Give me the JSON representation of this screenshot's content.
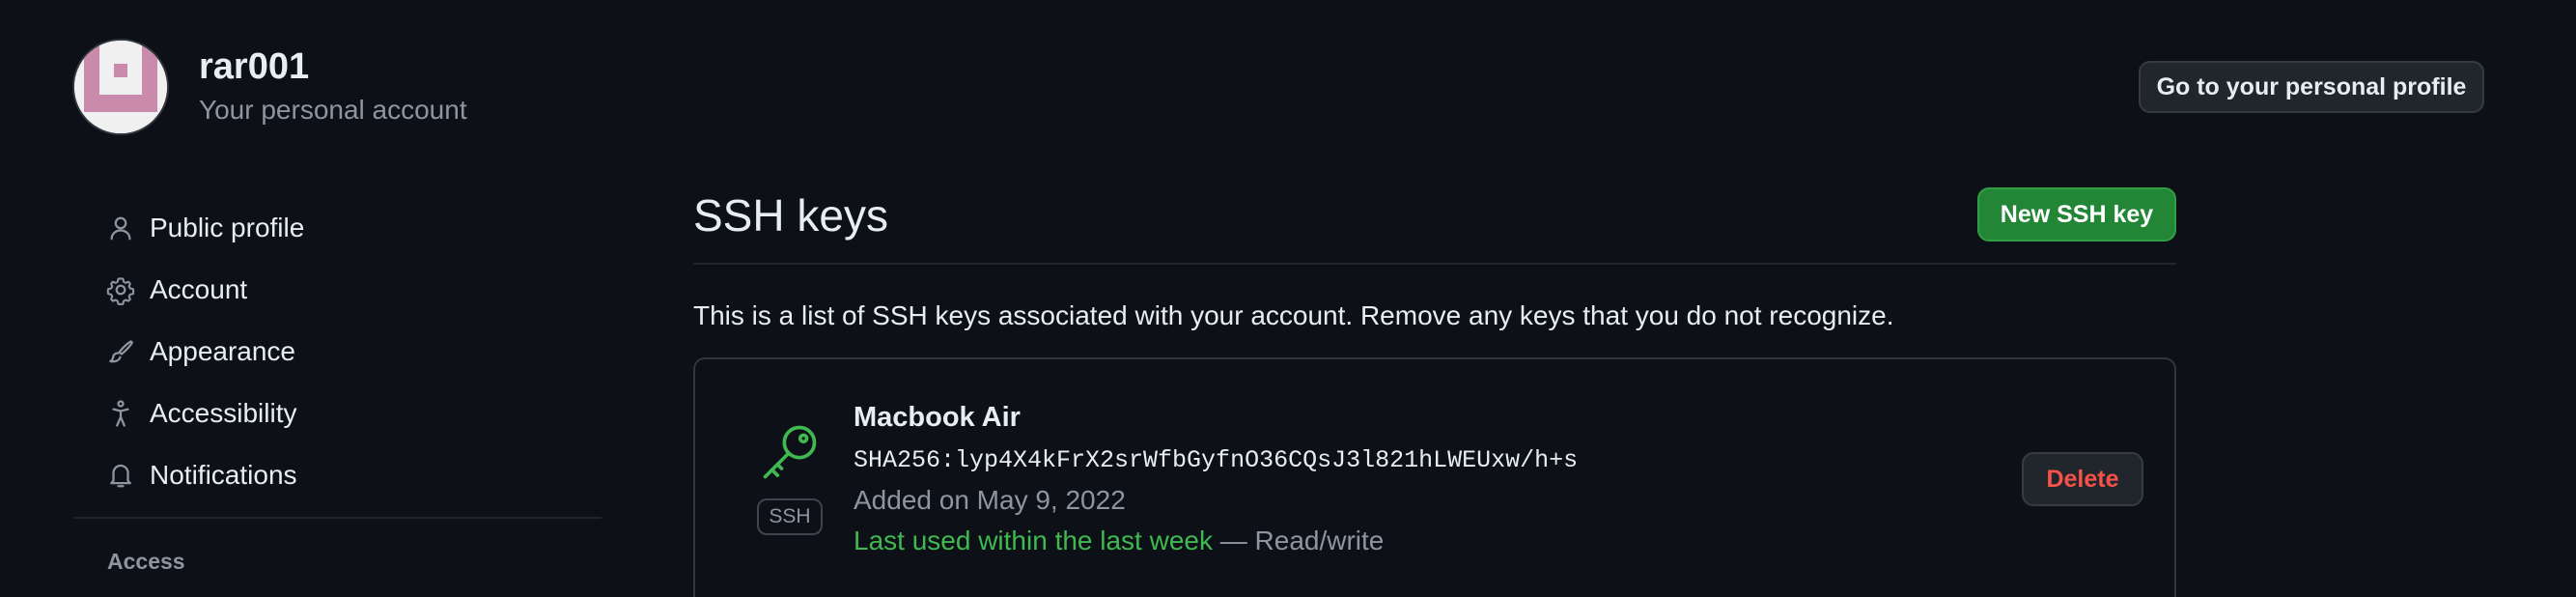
{
  "user": {
    "name": "rar001",
    "subtitle": "Your personal account",
    "profile_button": "Go to your personal profile"
  },
  "sidebar": {
    "items": [
      {
        "label": "Public profile",
        "icon": "person-icon"
      },
      {
        "label": "Account",
        "icon": "gear-icon"
      },
      {
        "label": "Appearance",
        "icon": "paintbrush-icon"
      },
      {
        "label": "Accessibility",
        "icon": "accessibility-icon"
      },
      {
        "label": "Notifications",
        "icon": "bell-icon"
      }
    ],
    "section_heading": "Access"
  },
  "main": {
    "title": "SSH keys",
    "new_button": "New SSH key",
    "description": "This is a list of SSH keys associated with your account. Remove any keys that you do not recognize."
  },
  "keys": [
    {
      "title": "Macbook Air",
      "fingerprint": "SHA256:lyp4X4kFrX2srWfbGyfnO36CQsJ3l821hLWEUxw/h+s",
      "added": "Added on May 9, 2022",
      "last_used": "Last used within the last week",
      "access": " — Read/write",
      "badge": "SSH",
      "delete_label": "Delete"
    }
  ],
  "colors": {
    "background": "#0d1117",
    "accent_green": "#238636",
    "recent_green": "#3fb950",
    "danger": "#f85149"
  }
}
